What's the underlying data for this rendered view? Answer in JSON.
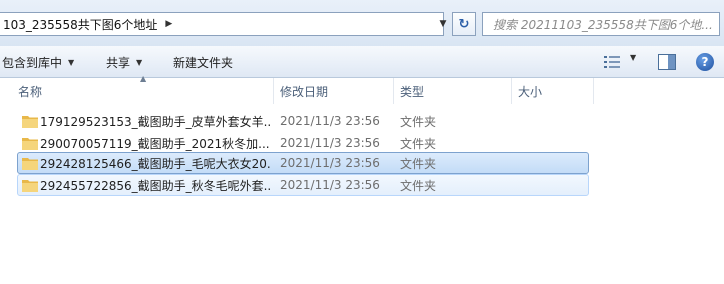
{
  "address_bar": {
    "path": "103_235558共下图6个地址",
    "search_placeholder": "搜索 20211103_235558共下图6个地..."
  },
  "toolbar": {
    "include_in_library": "包含到库中",
    "share": "共享",
    "new_folder": "新建文件夹"
  },
  "columns": {
    "name": "名称",
    "date_modified": "修改日期",
    "type": "类型",
    "size": "大小"
  },
  "files": [
    {
      "name": "179129523153_截图助手_皮草外套女羊...",
      "date": "2021/11/3 23:56",
      "type": "文件夹",
      "state": "normal"
    },
    {
      "name": "290070057119_截图助手_2021秋冬加...",
      "date": "2021/11/3 23:56",
      "type": "文件夹",
      "state": "normal"
    },
    {
      "name": "292428125466_截图助手_毛呢大衣女20...",
      "date": "2021/11/3 23:56",
      "type": "文件夹",
      "state": "selected"
    },
    {
      "name": "292455722856_截图助手_秋冬毛呢外套...",
      "date": "2021/11/3 23:56",
      "type": "文件夹",
      "state": "hover"
    }
  ],
  "colors": {
    "folder": "#f0c75e",
    "selection": "#c3dcf7",
    "hover": "#e4effc",
    "header_text": "#4c607a"
  },
  "icons": [
    "refresh-icon",
    "folder-icon",
    "view-options-icon",
    "preview-pane-icon",
    "help-icon"
  ]
}
